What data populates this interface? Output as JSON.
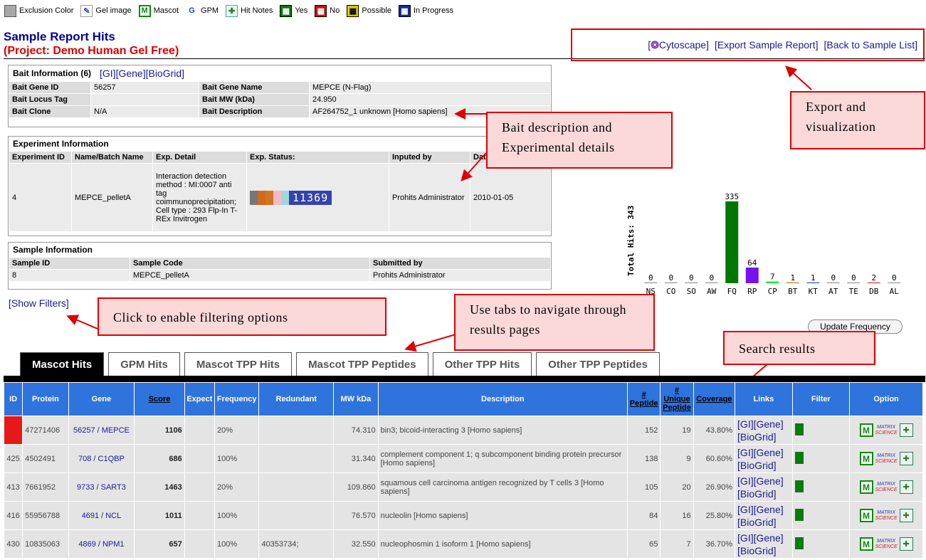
{
  "legend": [
    {
      "label": "Exclusion Color",
      "icon": "exclusion-color-icon"
    },
    {
      "label": "Gel image",
      "icon": "gel-image-icon"
    },
    {
      "label": "Mascot",
      "icon": "mascot-icon"
    },
    {
      "label": "GPM",
      "icon": "gpm-icon"
    },
    {
      "label": "Hit Notes",
      "icon": "hit-notes-icon"
    },
    {
      "label": "Yes",
      "icon": "yes-icon"
    },
    {
      "label": "No",
      "icon": "no-icon"
    },
    {
      "label": "Possible",
      "icon": "possible-icon"
    },
    {
      "label": "In Progress",
      "icon": "in-progress-icon"
    }
  ],
  "header": {
    "title": "Sample Report Hits",
    "project": "(Project: Demo Human Gel Free)"
  },
  "toplinks": {
    "cytoscape_open": "[",
    "cytoscape": "Cytoscape]",
    "export": "[Export Sample Report]",
    "back": "[Back to Sample List]"
  },
  "bait": {
    "title": "Bait Information (6)",
    "links": {
      "gi": "[GI]",
      "gene": "[Gene]",
      "biogrid": "[BioGrid]"
    },
    "rows": [
      {
        "k1": "Bait Gene ID",
        "v1": "56257",
        "k2": "Bait Gene Name",
        "v2": "MEPCE (N-Flag)"
      },
      {
        "k1": "Bait Locus Tag",
        "v1": "",
        "k2": "Bait MW (kDa)",
        "v2": "24.950"
      },
      {
        "k1": "Bait Clone",
        "v1": "N/A",
        "k2": "Bait Description",
        "v2": "AF264752_1 unknown [Homo sapiens]"
      }
    ]
  },
  "experiment": {
    "title": "Experiment Information",
    "headers": [
      "Experiment ID",
      "Name/Batch Name",
      "Exp. Detail",
      "Exp. Status:",
      "Inputed by",
      "Date"
    ],
    "row": {
      "id": "4",
      "name": "MEPCE_pelletA",
      "detail": "Interaction detection method : MI:0007 anti tag coimmunoprecipitation; Cell type : 293 Flp-In T-REx Invitrogen",
      "status_code": "11369",
      "status_colors": [
        "#777777",
        "#d2691e",
        "#cc7722",
        "#f4b8c8",
        "#9ed8d8"
      ],
      "inputed_by": "Prohits Administrator",
      "date": "2010-01-05"
    }
  },
  "sample": {
    "title": "Sample Information",
    "headers": [
      "Sample ID",
      "Sample Code",
      "Submitted by"
    ],
    "row": {
      "id": "8",
      "code": "MEPCE_pelletA",
      "submitted_by": "Prohits Administrator"
    }
  },
  "chart_data": {
    "type": "bar",
    "ylabel": "Total Hits: 343",
    "categories": [
      "NS",
      "CO",
      "SO",
      "AW",
      "FQ",
      "RP",
      "CP",
      "BT",
      "KT",
      "AT",
      "TE",
      "DB",
      "AL"
    ],
    "values": [
      0,
      0,
      0,
      0,
      335,
      64,
      7,
      1,
      1,
      0,
      0,
      2,
      0
    ],
    "colors": [
      "#888888",
      "#888888",
      "#888888",
      "#888888",
      "#007700",
      "#7711ee",
      "#11ee33",
      "#aa6600",
      "#1133cc",
      "#888888",
      "#888888",
      "#ee1111",
      "#888888"
    ],
    "ylim": [
      0,
      335
    ]
  },
  "show_filters": "[Show Filters]",
  "update_frequency": "Update Frequency",
  "callouts": {
    "export": "Export and visualization",
    "bait": "Bait description and Experimental details",
    "filter": "Click to enable filtering options",
    "tabs": "Use tabs to navigate through results pages",
    "search": "Search results"
  },
  "tabs": [
    "Mascot Hits",
    "GPM Hits",
    "Mascot TPP Hits",
    "Mascot TPP Peptides",
    "Other TPP Hits",
    "Other TPP Peptides"
  ],
  "table": {
    "headers": [
      "ID",
      "Protein",
      "Gene",
      "Score",
      "Expect",
      "Frequency",
      "Redundant",
      "MW kDa",
      "Description",
      "# Peptide",
      "# Unique Peptide",
      "Coverage",
      "Links",
      "Filter",
      "Option"
    ],
    "rows": [
      {
        "id": "",
        "protein": "47271406",
        "gene": "56257 / MEPCE",
        "score": "1106",
        "expect": "",
        "frequency": "20%",
        "redundant": "",
        "mw": "74.310",
        "desc": "bin3; bicoid-interacting 3 [Homo sapiens]",
        "peptide": "152",
        "unique": "19",
        "coverage": "43.80%"
      },
      {
        "id": "425",
        "protein": "4502491",
        "gene": "708 / C1QBP",
        "score": "686",
        "expect": "",
        "frequency": "100%",
        "redundant": "",
        "mw": "31.340",
        "desc": "complement component 1; q subcomponent binding protein precursor [Homo sapiens]",
        "peptide": "138",
        "unique": "9",
        "coverage": "60.60%"
      },
      {
        "id": "413",
        "protein": "7661952",
        "gene": "9733 / SART3",
        "score": "1463",
        "expect": "",
        "frequency": "20%",
        "redundant": "",
        "mw": "109.860",
        "desc": "squamous cell carcinoma antigen recognized by T cells 3 [Homo sapiens]",
        "peptide": "105",
        "unique": "20",
        "coverage": "26.90%"
      },
      {
        "id": "416",
        "protein": "55956788",
        "gene": "4691 / NCL",
        "score": "1011",
        "expect": "",
        "frequency": "100%",
        "redundant": "",
        "mw": "76.570",
        "desc": "nucleolin [Homo sapiens]",
        "peptide": "84",
        "unique": "16",
        "coverage": "25.80%"
      },
      {
        "id": "430",
        "protein": "10835063",
        "gene": "4869 / NPM1",
        "score": "657",
        "expect": "",
        "frequency": "100%",
        "redundant": "40353734;",
        "mw": "32.550",
        "desc": "nucleophosmin 1 isoform 1 [Homo sapiens]",
        "peptide": "65",
        "unique": "7",
        "coverage": "36.70%"
      }
    ],
    "links": {
      "gi": "[GI]",
      "gene": "[Gene]",
      "biogrid": "[BioGrid]"
    },
    "option_mascot": "M",
    "option_matrix": "MATRIX",
    "option_science": "SCIENCE"
  }
}
